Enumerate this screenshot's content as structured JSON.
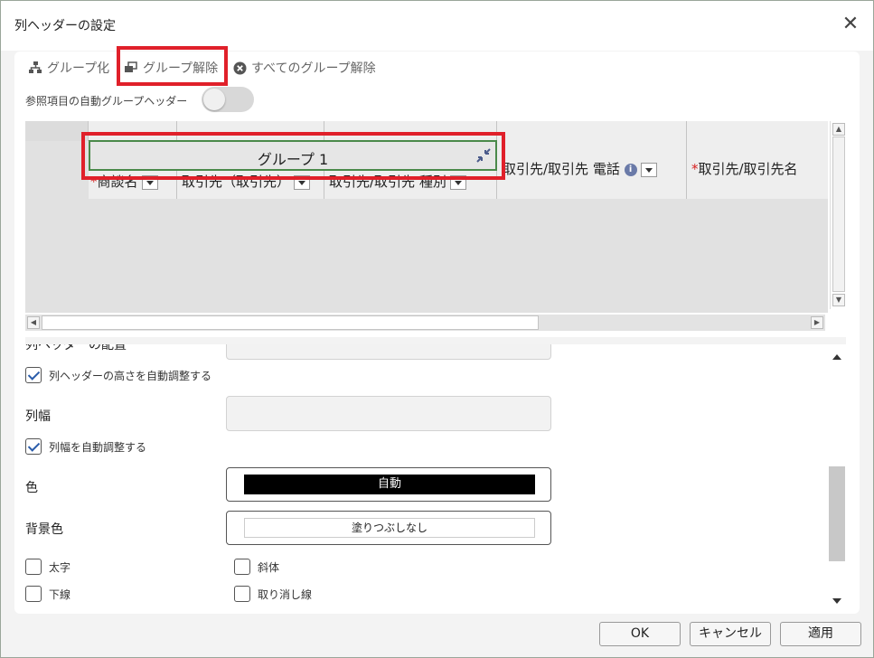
{
  "dialog": {
    "title": "列ヘッダーの設定",
    "close_glyph": "✕"
  },
  "toolbar": {
    "group_label": "グループ化",
    "ungroup_label": "グループ解除",
    "ungroup_all_label": "すべてのグループ解除"
  },
  "auto_group": {
    "label": "参照項目の自動グループヘッダー",
    "enabled": false
  },
  "grid": {
    "group_header": "グループ 1",
    "columns": [
      {
        "label": "商談名",
        "required": true
      },
      {
        "label": "取引先（取引先）",
        "required": false
      },
      {
        "label": "取引先/取引先 種別",
        "required": false
      },
      {
        "label": "取引先/取引先 電話",
        "required": false,
        "info_icon": true
      },
      {
        "label": "取引先/取引先名",
        "required": true
      }
    ],
    "required_mark": "*",
    "info_glyph": "i"
  },
  "form": {
    "partial_label": "列ヘッダーの配置",
    "auto_height_label": "列ヘッダーの高さを自動調整する",
    "auto_height_checked": true,
    "width_label": "列幅",
    "auto_width_label": "列幅を自動調整する",
    "auto_width_checked": true,
    "color_label": "色",
    "color_value": "自動",
    "bg_label": "背景色",
    "bg_value": "塗りつぶしなし",
    "bold_label": "太字",
    "italic_label": "斜体",
    "underline_label": "下線",
    "strike_label": "取り消し線"
  },
  "footer": {
    "ok": "OK",
    "cancel": "キャンセル",
    "apply": "適用"
  },
  "colors": {
    "highlight_red": "#e0202a",
    "group_border_green": "#4a8a4a",
    "required_red": "#d62020",
    "check_blue": "#2a5caa"
  }
}
